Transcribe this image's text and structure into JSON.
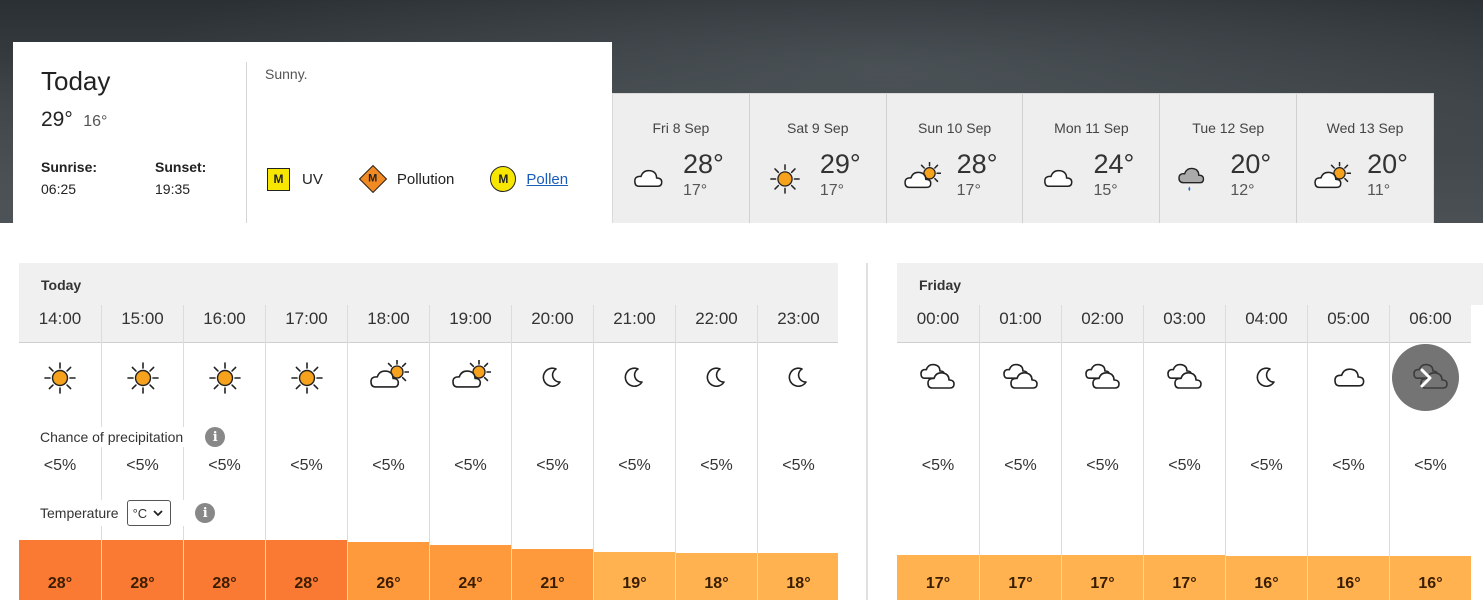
{
  "today": {
    "title": "Today",
    "high": "29°",
    "low": "16°",
    "sunrise_label": "Sunrise:",
    "sunrise": "06:25",
    "sunset_label": "Sunset:",
    "sunset": "19:35",
    "summary": "Sunny.",
    "indicators": {
      "uv": {
        "badge": "M",
        "label": "UV"
      },
      "pollution": {
        "badge": "M",
        "label": "Pollution"
      },
      "pollen": {
        "badge": "M",
        "label": "Pollen"
      }
    }
  },
  "forecast_days": [
    {
      "date": "Fri 8 Sep",
      "high": "28°",
      "low": "17°",
      "icon": "cloud-icon"
    },
    {
      "date": "Sat 9 Sep",
      "high": "29°",
      "low": "17°",
      "icon": "sun-icon"
    },
    {
      "date": "Sun 10 Sep",
      "high": "28°",
      "low": "17°",
      "icon": "sun-cloud-icon"
    },
    {
      "date": "Mon 11 Sep",
      "high": "24°",
      "low": "15°",
      "icon": "cloud-icon"
    },
    {
      "date": "Tue 12 Sep",
      "high": "20°",
      "low": "12°",
      "icon": "rain-cloud-icon"
    },
    {
      "date": "Wed 13 Sep",
      "high": "20°",
      "low": "11°",
      "icon": "sun-cloud-icon"
    }
  ],
  "hourly": {
    "precip_label": "Chance of precipitation",
    "temp_label": "Temperature",
    "unit": "°C",
    "days": [
      {
        "name": "Today",
        "hours": [
          {
            "time": "14:00",
            "icon": "sun-icon",
            "precip": "<5%",
            "temp": "28°",
            "temp_value": 28
          },
          {
            "time": "15:00",
            "icon": "sun-icon",
            "precip": "<5%",
            "temp": "28°",
            "temp_value": 28
          },
          {
            "time": "16:00",
            "icon": "sun-icon",
            "precip": "<5%",
            "temp": "28°",
            "temp_value": 28
          },
          {
            "time": "17:00",
            "icon": "sun-icon",
            "precip": "<5%",
            "temp": "28°",
            "temp_value": 28
          },
          {
            "time": "18:00",
            "icon": "sun-cloud-icon",
            "precip": "<5%",
            "temp": "26°",
            "temp_value": 26
          },
          {
            "time": "19:00",
            "icon": "sun-cloud-icon",
            "precip": "<5%",
            "temp": "24°",
            "temp_value": 24
          },
          {
            "time": "20:00",
            "icon": "moon-icon",
            "precip": "<5%",
            "temp": "21°",
            "temp_value": 21
          },
          {
            "time": "21:00",
            "icon": "moon-icon",
            "precip": "<5%",
            "temp": "19°",
            "temp_value": 19
          },
          {
            "time": "22:00",
            "icon": "moon-icon",
            "precip": "<5%",
            "temp": "18°",
            "temp_value": 18
          },
          {
            "time": "23:00",
            "icon": "moon-icon",
            "precip": "<5%",
            "temp": "18°",
            "temp_value": 18
          }
        ]
      },
      {
        "name": "Friday",
        "hours": [
          {
            "time": "00:00",
            "icon": "clouds-icon",
            "precip": "<5%",
            "temp": "17°",
            "temp_value": 17
          },
          {
            "time": "01:00",
            "icon": "clouds-icon",
            "precip": "<5%",
            "temp": "17°",
            "temp_value": 17
          },
          {
            "time": "02:00",
            "icon": "clouds-icon",
            "precip": "<5%",
            "temp": "17°",
            "temp_value": 17
          },
          {
            "time": "03:00",
            "icon": "clouds-icon",
            "precip": "<5%",
            "temp": "17°",
            "temp_value": 17
          },
          {
            "time": "04:00",
            "icon": "moon-icon",
            "precip": "<5%",
            "temp": "16°",
            "temp_value": 16
          },
          {
            "time": "05:00",
            "icon": "cloud-icon",
            "precip": "<5%",
            "temp": "16°",
            "temp_value": 16
          },
          {
            "time": "06:00",
            "icon": "clouds-icon",
            "precip": "<5%",
            "temp": "16°",
            "temp_value": 16
          }
        ]
      }
    ]
  },
  "colors": {
    "hot": "#fb7a33",
    "warm": "#ff9a3c",
    "mild": "#ffb24f",
    "sun": "#f6a21d",
    "pollen_link": "#1a5db8"
  }
}
